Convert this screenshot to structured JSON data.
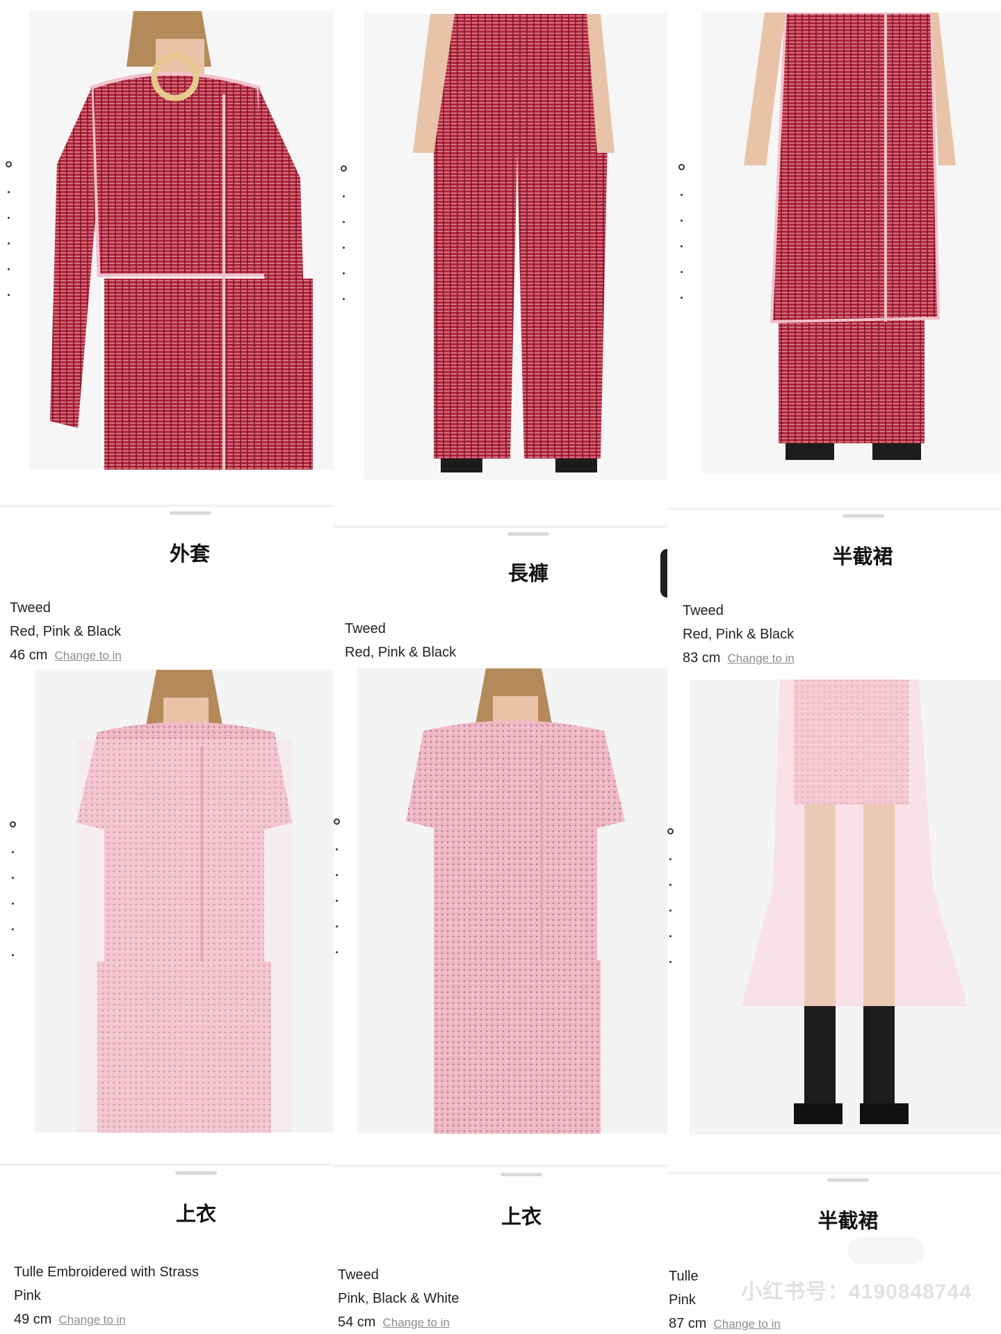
{
  "cards": [
    {
      "title": "外套",
      "material": "Tweed",
      "color": "Red, Pink & Black",
      "length": "46 cm",
      "link": "Change to in"
    },
    {
      "title": "長褲",
      "material": "Tweed",
      "color": "Red, Pink & Black",
      "length": "",
      "link": ""
    },
    {
      "title": "半截裙",
      "material": "Tweed",
      "color": "Red, Pink & Black",
      "length": "83 cm",
      "link": "Change to in"
    },
    {
      "title": "上衣",
      "material": "Tulle Embroidered with Strass",
      "color": "Pink",
      "length": "49 cm",
      "link": "Change to in"
    },
    {
      "title": "上衣",
      "material": "Tweed",
      "color": "Pink, Black & White",
      "length": "54 cm",
      "link": "Change to in"
    },
    {
      "title": "半截裙",
      "material": "Tulle",
      "color": "Pink",
      "length": "87 cm",
      "link": "Change to in"
    }
  ],
  "photos": [
    {
      "icon": "red-tweed-jacket-photo"
    },
    {
      "icon": "red-tweed-pants-photo"
    },
    {
      "icon": "red-tweed-skirt-over-pants-photo"
    },
    {
      "icon": "pink-tulle-top-photo"
    },
    {
      "icon": "pink-tweed-top-photo"
    },
    {
      "icon": "pink-tulle-skirt-photo"
    }
  ],
  "watermark": "小红书号：4190848744",
  "colors": {
    "red_tweed": "#b2243a",
    "pink_tweed": "#f0b6c4",
    "skin": "#e9c3a8",
    "hair": "#b58a5a"
  }
}
